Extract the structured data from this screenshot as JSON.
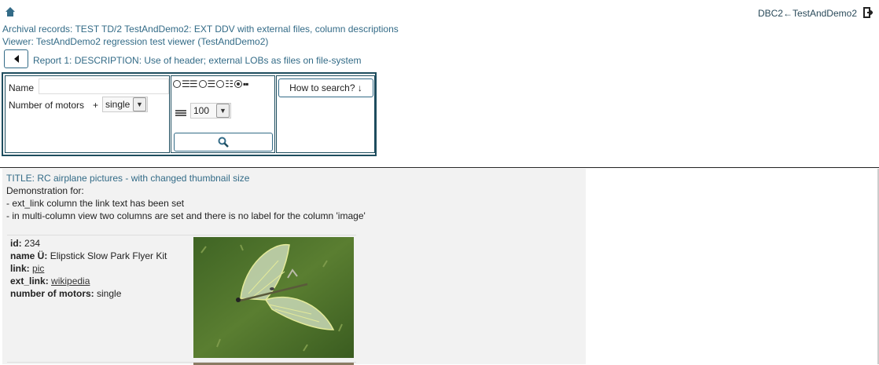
{
  "header": {
    "app_title": "DBC2←TestAndDemo2",
    "archival_records": "Archival records: TEST TD/2 TestAndDemo2: EXT DDV with external files, column descriptions",
    "viewer": "Viewer: TestAndDemo2 regression test viewer (TestAndDemo2)",
    "report_title": "Report 1: DESCRIPTION: Use of header; external LOBs as files on file-system"
  },
  "search": {
    "name_label": "Name",
    "name_value": "",
    "motors_label": "Number of motors",
    "motors_plus": "+",
    "motors_selected": "single",
    "rows_selected": "100",
    "help_label": "How to search? ↓",
    "view_modes": [
      {
        "glyph": "☰☰",
        "selected": false
      },
      {
        "glyph": "☰",
        "selected": false
      },
      {
        "glyph": "☷",
        "selected": false
      },
      {
        "glyph": "▪▪",
        "selected": true
      }
    ]
  },
  "result": {
    "title": "TITLE: RC airplane pictures - with changed thumbnail size",
    "description_lines": [
      "Demonstration for:",
      "- ext_link column the link text has been set",
      "- in multi-column view two columns are set and there is no label for the column 'image'"
    ],
    "record": {
      "id_label": "id:",
      "id_value": "234",
      "name_label": "name Ü:",
      "name_value": "Elipstick Slow Park Flyer Kit",
      "link_label": "link:",
      "link_value": "pic",
      "ext_link_label": "ext_link:",
      "ext_link_value": "wikipedia",
      "motors_label": "number of motors:",
      "motors_value": "single"
    }
  },
  "colors": {
    "accent": "#336b87",
    "border": "#1e4d5e",
    "panel_bg": "#f2f2f2"
  }
}
